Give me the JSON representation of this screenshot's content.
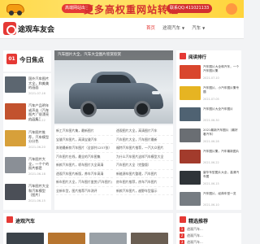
{
  "ad": {
    "small_badge": "高端网站出售",
    "headline": "更多高权重网站转让",
    "contact": "联系QQ:411021133"
  },
  "header": {
    "logo_text": "途观车友会",
    "nav": [
      {
        "label": "首页",
        "active": true
      },
      {
        "label": "途观汽车",
        "active": false,
        "dropdown": true
      },
      {
        "label": "汽车",
        "active": false,
        "dropdown": true
      }
    ]
  },
  "focus": {
    "day": "01",
    "title": "今日焦点"
  },
  "left_list": [
    {
      "title": "国外汽车图片大全，和美美的画面",
      "date": "2021-07-16",
      "color": "#5c6670"
    },
    {
      "title": "汽车产品明年或声出（汽车图片）”很漂亮的画集”",
      "date": "2021-06-22",
      "color": "#c2522e"
    },
    {
      "title": "汽车图片推荐，汽车模型分分色",
      "date": "2021-06-20",
      "color": "#d7a03a"
    },
    {
      "title": "汽车图片大全，一个个的照片都是",
      "date": "2021-06-18",
      "color": "#8a8f96"
    },
    {
      "title": "汽车图片大全和汽车模型（图片）",
      "date": "2021-06-15",
      "color": "#4b4f57"
    }
  ],
  "hero": {
    "caption": "汽车图片大全，汽车大全图片欣赏欣赏"
  },
  "articles_left": [
    "新工汽车图片集，最新图片",
    "宝骏汽车图片，高清宝骏汽车",
    "奔驰最新款汽车图片（全部共1257张）",
    "汽车图片在线，最全的汽车图集",
    "新款汽车图片，轿车图片大全高清",
    "途观汽车图片新版，养车汽车高清",
    "新车图片大全，汽车图片鉴赏(汽车图片)",
    "全新车型，图片推荐汽车测评"
  ],
  "articles_right": [
    "途观图片大全，高清图片汽车",
    "汽车图片大全，汽车图片最新",
    "福特汽车图片推荐，一汽大众图片",
    "为什么汽车图片这样汽车模型大全",
    "汽车图片大全（完整版）",
    "新能源车图片整理，汽车图片",
    "房车图片推荐，房车汽车图片",
    "新款汽车图片，越野车型展示"
  ],
  "rank": {
    "title": "阅读排行",
    "items": [
      {
        "title": "汽车图片大全和汽车，一个汽车图片集",
        "date": "2021-07-10",
        "color": "#d9462d"
      },
      {
        "title": "汽车图片，小汽车图片集专题",
        "date": "2021-07-05",
        "color": "#e6b422"
      },
      {
        "title": "汽车图片大全汽车图片",
        "date": "2021-06-30",
        "color": "#4f6272"
      },
      {
        "title": "2021最新汽车图片（最好看汽车）",
        "date": "2021-06-28",
        "color": "#6a6e73"
      },
      {
        "title": "汽车图片集，汽车最新图片",
        "date": "2021-06-22",
        "color": "#a23b2c"
      },
      {
        "title": "豪华车型图片大全，高清汽车图",
        "date": "2021-06-15",
        "color": "#2f3438"
      },
      {
        "title": "汽车图片，经典车型一览",
        "date": "2021-06-10",
        "color": "#767c82"
      }
    ]
  },
  "bottom": {
    "cars_title": "途观汽车",
    "cars_thumbs": [
      "#3c434a",
      "#b7752f",
      "#9aa1a7",
      "#6a5e52"
    ],
    "picks_title": "精选推荐",
    "picks": [
      {
        "num": "1",
        "text": "途观汽车..."
      },
      {
        "num": "2",
        "text": "途观汽车..."
      },
      {
        "num": "3",
        "text": "途观汽车..."
      }
    ]
  },
  "colors": {
    "accent": "#e53935",
    "ad_background": "#ffd84a"
  }
}
